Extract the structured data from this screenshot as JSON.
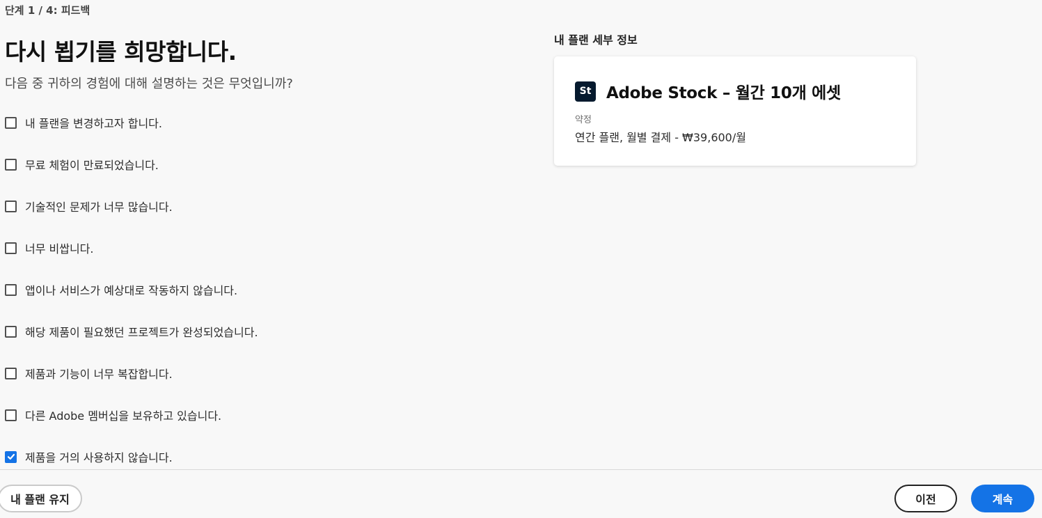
{
  "step": {
    "label": "단계 1 / 4: 피드백"
  },
  "title": "다시 뵙기를 희망합니다.",
  "subtitle": "다음 중 귀하의 경험에 대해 설명하는 것은 무엇입니까?",
  "options": [
    {
      "label": "내 플랜을 변경하고자 합니다.",
      "checked": false
    },
    {
      "label": "무료 체험이 만료되었습니다.",
      "checked": false
    },
    {
      "label": "기술적인 문제가 너무 많습니다.",
      "checked": false
    },
    {
      "label": "너무 비쌉니다.",
      "checked": false
    },
    {
      "label": "앱이나 서비스가 예상대로 작동하지 않습니다.",
      "checked": false
    },
    {
      "label": "해당 제품이 필요했던 프로젝트가 완성되었습니다.",
      "checked": false
    },
    {
      "label": "제품과 기능이 너무 복잡합니다.",
      "checked": false
    },
    {
      "label": "다른 Adobe 멤버십을 보유하고 있습니다.",
      "checked": false
    },
    {
      "label": "제품을 거의 사용하지 않습니다.",
      "checked": true
    }
  ],
  "plan": {
    "heading": "내 플랜 세부 정보",
    "app_icon_text": "St",
    "name": "Adobe Stock – 월간 10개 에셋",
    "term_label": "약정",
    "term_value": "연간 플랜, 월별 결제 - ₩39,600/월"
  },
  "footer": {
    "keep_label": "내 플랜 유지",
    "prev_label": "이전",
    "continue_label": "계속"
  },
  "colors": {
    "accent": "#1473e6",
    "app_icon_bg": "#061a2e"
  }
}
